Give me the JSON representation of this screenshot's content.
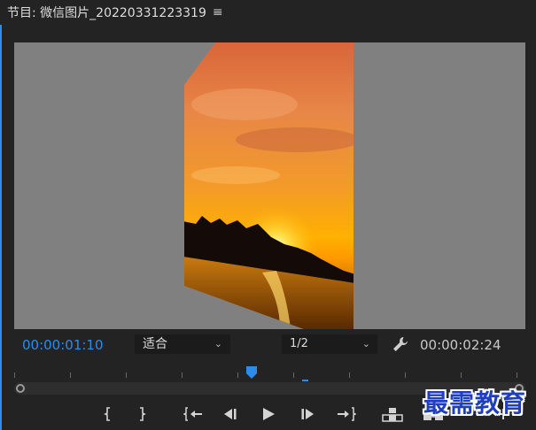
{
  "panel": {
    "title": "节目: 微信图片_20220331223319",
    "menu_icon": "hamburger-menu-icon"
  },
  "viewer": {
    "content": "sunset-over-water-image-3d-rotated"
  },
  "controls": {
    "current_timecode": "00:00:01:10",
    "fit_select_value": "适合",
    "resolution_select_value": "1/2",
    "settings_icon": "wrench-icon",
    "duration_timecode": "00:00:02:24"
  },
  "transport": {
    "buttons": [
      {
        "name": "mark-in-icon",
        "glyph": "{"
      },
      {
        "name": "mark-out-icon",
        "glyph": "}"
      },
      {
        "name": "go-to-in-icon",
        "glyph": "{←"
      },
      {
        "name": "step-back-icon",
        "glyph": "◀|"
      },
      {
        "name": "play-icon",
        "glyph": "▶"
      },
      {
        "name": "step-forward-icon",
        "glyph": "|▶"
      },
      {
        "name": "go-to-out-icon",
        "glyph": "→}"
      },
      {
        "name": "lift-icon",
        "glyph": "lift"
      },
      {
        "name": "extract-icon",
        "glyph": "extract"
      },
      {
        "name": "add-button-icon",
        "glyph": "+"
      }
    ]
  },
  "watermark": {
    "text": "最需教育"
  },
  "colors": {
    "accent": "#2d8ceb",
    "panel_bg": "#232323",
    "viewer_bg": "#808080"
  }
}
